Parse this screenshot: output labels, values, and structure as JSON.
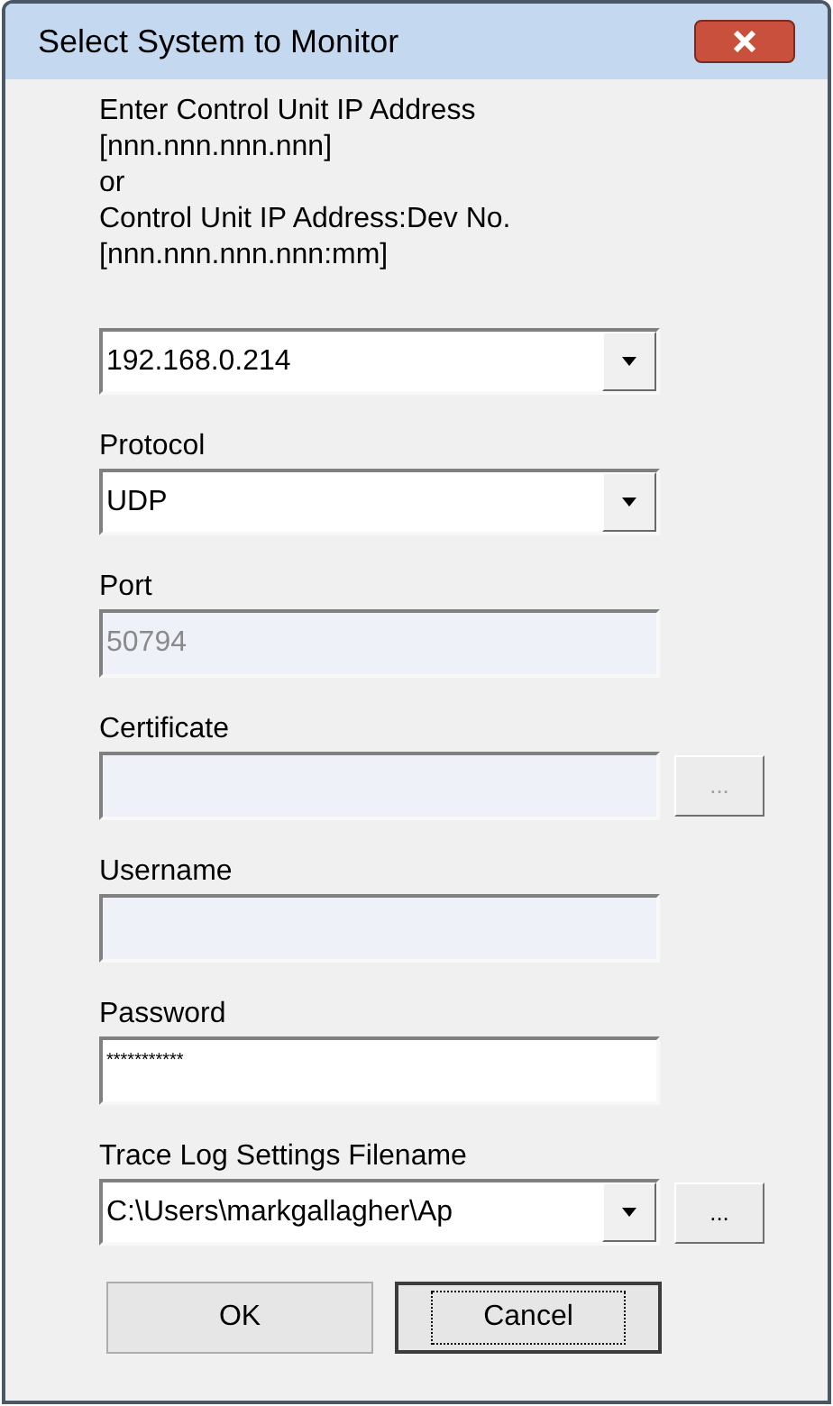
{
  "window": {
    "title": "Select System to Monitor"
  },
  "intro_lines": [
    "Enter Control Unit IP Address",
    "[nnn.nnn.nnn.nnn]",
    "or",
    "Control Unit IP Address:Dev No.",
    "[nnn.nnn.nnn.nnn:mm]"
  ],
  "fields": [
    {
      "kind": "combo",
      "value": "192.168.0.214",
      "disabled": false
    },
    {
      "kind": "combo",
      "label": "Protocol",
      "value": "UDP",
      "disabled": false
    },
    {
      "kind": "text",
      "label": "Port",
      "value": "50794",
      "disabled": true
    },
    {
      "kind": "text",
      "label": "Certificate",
      "disabled": true,
      "browse": true,
      "browse_label": "...",
      "browse_disabled": true
    },
    {
      "kind": "text",
      "label": "Username",
      "disabled": true
    },
    {
      "kind": "password",
      "label": "Password",
      "value": "***********",
      "disabled": false
    },
    {
      "kind": "combo",
      "label": "Trace Log Settings Filename",
      "value": "C:\\Users\\markgallagher\\Ap",
      "disabled": false,
      "browse": true,
      "browse_label": "...",
      "browse_disabled": false
    }
  ],
  "buttons": [
    {
      "label": "OK",
      "focused": false
    },
    {
      "label": "Cancel",
      "focused": true
    }
  ]
}
